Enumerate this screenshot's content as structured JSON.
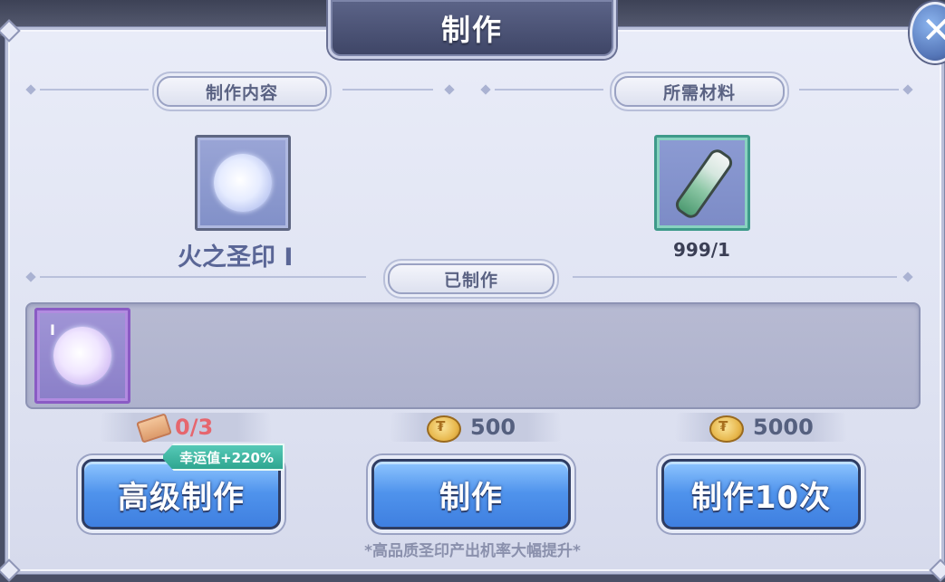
{
  "title": "制作",
  "close_icon": "close-icon",
  "sections": {
    "craft_content": "制作内容",
    "materials": "所需材料",
    "crafted": "已制作"
  },
  "craft_item": {
    "name": "火之圣印 Ⅰ",
    "icon": "holy-seal-orb-icon"
  },
  "material": {
    "icon": "potion-vial-icon",
    "count": "999/1"
  },
  "crafted_items": [
    {
      "icon": "holy-seal-orb-icon",
      "tier": "Ⅰ"
    }
  ],
  "costs": {
    "advanced": {
      "icon": "ticket-icon",
      "value": "0/3"
    },
    "single": {
      "icon": "gold-coin-icon",
      "value": "500"
    },
    "ten": {
      "icon": "gold-coin-icon",
      "value": "5000"
    }
  },
  "buttons": {
    "advanced": "高级制作",
    "single": "制作",
    "ten": "制作10次"
  },
  "luck_tag": "幸运值+220%",
  "footnote": "*高品质圣印产出机率大幅提升*"
}
